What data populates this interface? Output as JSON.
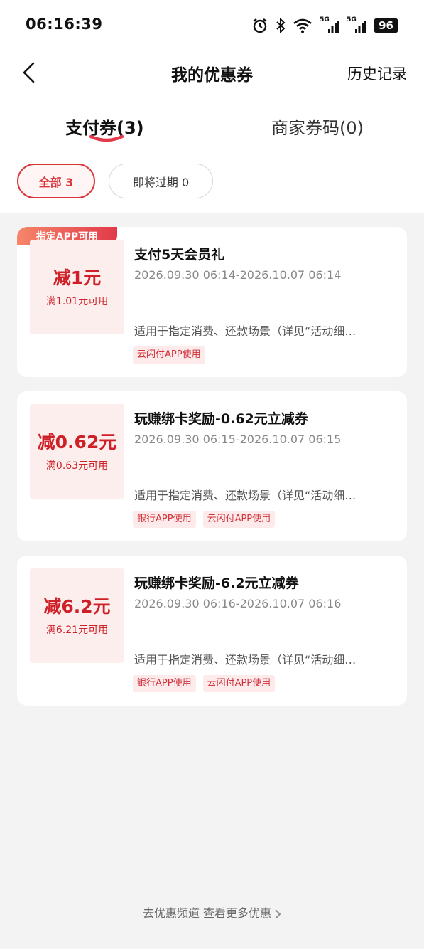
{
  "status_bar": {
    "time": "06:16:39",
    "battery": "96",
    "network_1": "5G",
    "network_2": "5G"
  },
  "header": {
    "title": "我的优惠券",
    "history": "历史记录"
  },
  "tabs": [
    {
      "label": "支付券(3)",
      "active": true
    },
    {
      "label": "商家券码(0)",
      "active": false
    }
  ],
  "filters": [
    {
      "label": "全部 3",
      "active": true
    },
    {
      "label": "即将过期 0",
      "active": false
    }
  ],
  "coupons": [
    {
      "badge": "指定APP可用",
      "amount": "减1元",
      "condition": "满1.01元可用",
      "title": "支付5天会员礼",
      "period": "2026.09.30 06:14-2026.10.07 06:14",
      "scope": "适用于指定消费、还款场景（详见“活动细…",
      "tags": [
        "云闪付APP使用"
      ]
    },
    {
      "amount": "减0.62元",
      "condition": "满0.63元可用",
      "title": "玩赚绑卡奖励-0.62元立减券",
      "period": "2026.09.30 06:15-2026.10.07 06:15",
      "scope": "适用于指定消费、还款场景（详见“活动细…",
      "tags": [
        "银行APP使用",
        "云闪付APP使用"
      ]
    },
    {
      "amount": "减6.2元",
      "condition": "满6.21元可用",
      "title": "玩赚绑卡奖励-6.2元立减券",
      "period": "2026.09.30 06:16-2026.10.07 06:16",
      "scope": "适用于指定消费、还款场景（详见“活动细…",
      "tags": [
        "银行APP使用",
        "云闪付APP使用"
      ]
    }
  ],
  "footer": {
    "link": "去优惠频道 查看更多优惠"
  },
  "colors": {
    "accent": "#cf2027",
    "background": "#f3f3f3"
  }
}
